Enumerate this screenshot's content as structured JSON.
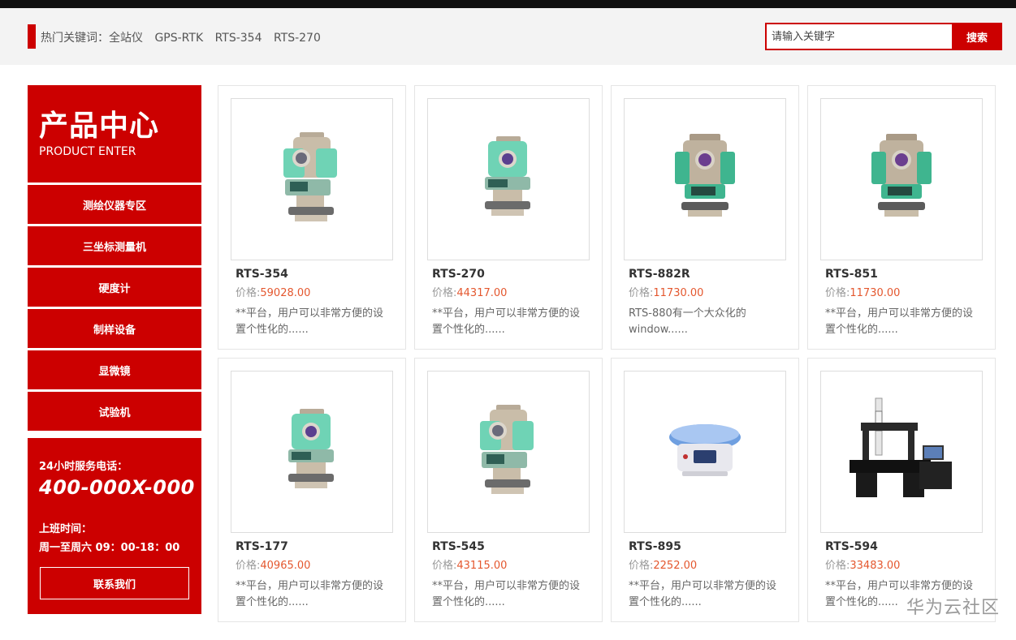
{
  "header": {
    "hot_label": "热门关键词：",
    "keywords": [
      "全站仪",
      "GPS-RTK",
      "RTS-354",
      "RTS-270"
    ],
    "search_placeholder": "请输入关键字",
    "search_button": "搜索"
  },
  "sidebar": {
    "title": "产品中心",
    "subtitle": "PRODUCT ENTER",
    "items": [
      {
        "label": "测绘仪器专区"
      },
      {
        "label": "三坐标测量机"
      },
      {
        "label": "硬度计"
      },
      {
        "label": "制样设备"
      },
      {
        "label": "显微镜"
      },
      {
        "label": "试验机"
      }
    ],
    "contact": {
      "phone_label": "24小时服务电话：",
      "phone": "400-000X-000",
      "hours_label": "上班时间：",
      "hours": "周一至周六  09：00-18：00",
      "button": "联系我们"
    }
  },
  "products": [
    {
      "name": "RTS-354",
      "price_label": "价格:",
      "price": "59028.00",
      "desc": "**平台，用户可以非常方便的设置个性化的......",
      "icon": "total-station"
    },
    {
      "name": "RTS-270",
      "price_label": "价格:",
      "price": "44317.00",
      "desc": "**平台，用户可以非常方便的设置个性化的......",
      "icon": "total-station"
    },
    {
      "name": "RTS-882R",
      "price_label": "价格:",
      "price": "11730.00",
      "desc": "RTS-880有一个大众化的window......",
      "icon": "total-station-gray"
    },
    {
      "name": "RTS-851",
      "price_label": "价格:",
      "price": "11730.00",
      "desc": "**平台，用户可以非常方便的设置个性化的......",
      "icon": "total-station-gray"
    },
    {
      "name": "RTS-177",
      "price_label": "价格:",
      "price": "40965.00",
      "desc": "**平台，用户可以非常方便的设置个性化的......",
      "icon": "total-station"
    },
    {
      "name": "RTS-545",
      "price_label": "价格:",
      "price": "43115.00",
      "desc": "**平台，用户可以非常方便的设置个性化的......",
      "icon": "total-station"
    },
    {
      "name": "RTS-895",
      "price_label": "价格:",
      "price": "2252.00",
      "desc": "**平台，用户可以非常方便的设置个性化的......",
      "icon": "gnss-receiver"
    },
    {
      "name": "RTS-594",
      "price_label": "价格:",
      "price": "33483.00",
      "desc": "**平台，用户可以非常方便的设置个性化的......",
      "icon": "cmm-machine"
    }
  ],
  "watermark": "华为云社区",
  "colors": {
    "brand_red": "#cc0000",
    "price_orange": "#e4572e"
  }
}
